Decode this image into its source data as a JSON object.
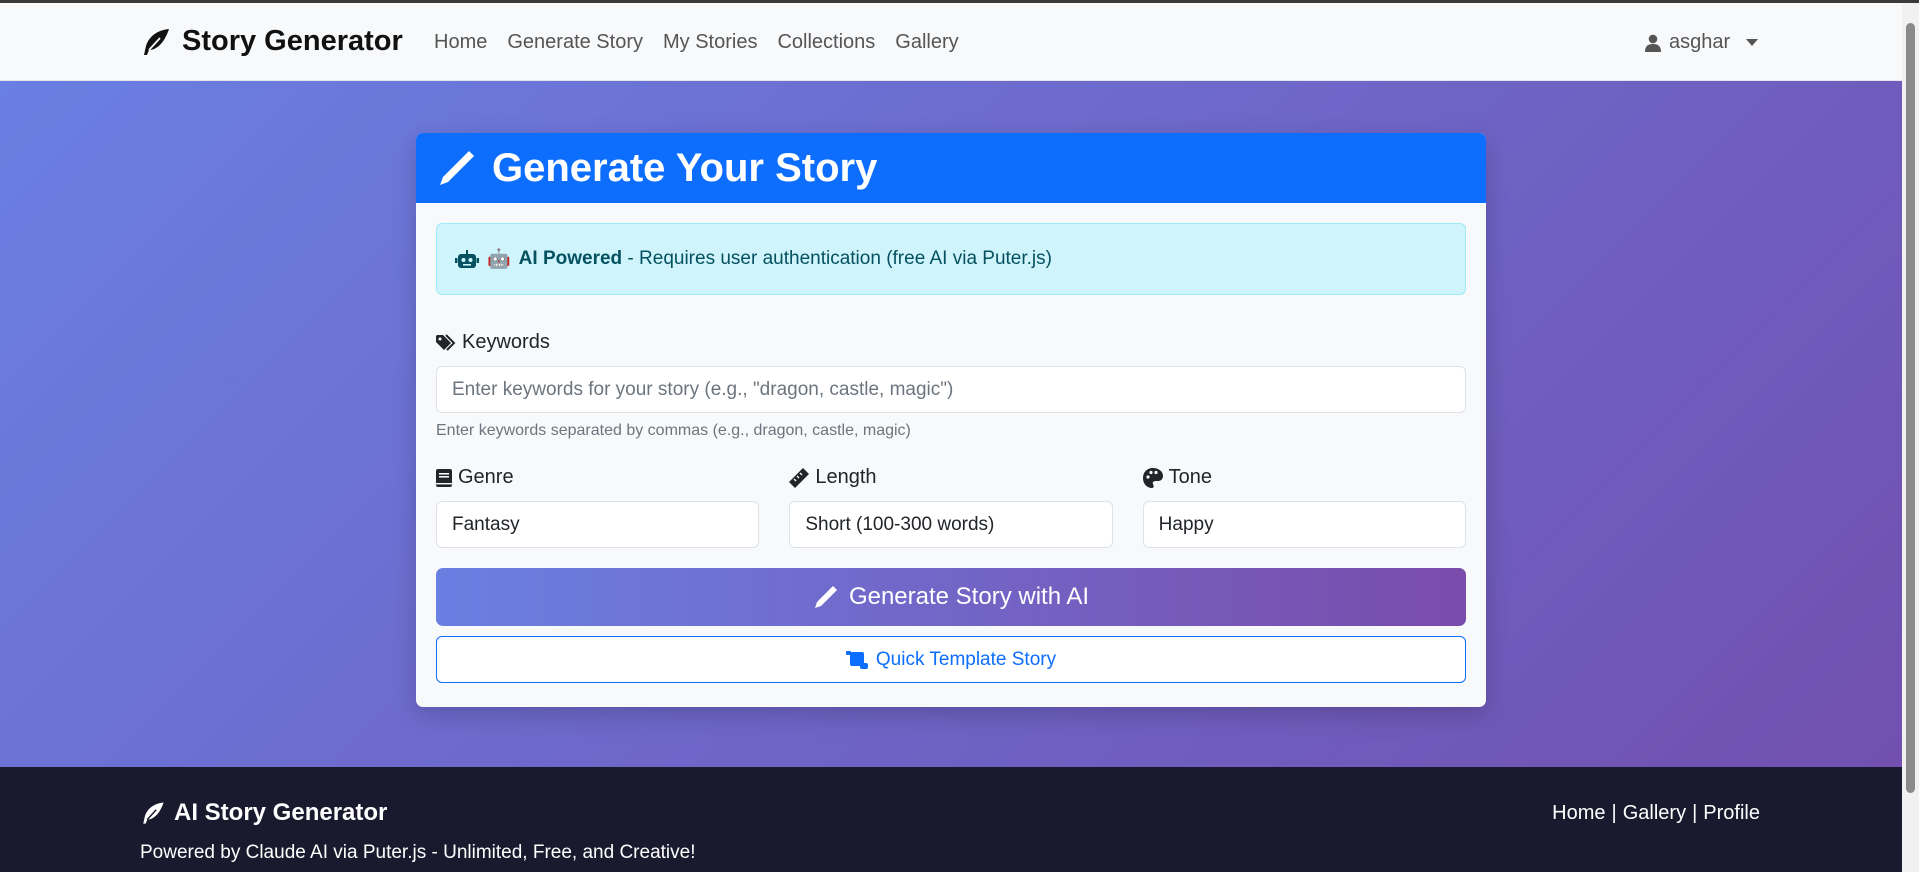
{
  "navbar": {
    "brand": "Story Generator",
    "links": [
      "Home",
      "Generate Story",
      "My Stories",
      "Collections",
      "Gallery"
    ],
    "user": "asghar"
  },
  "card": {
    "title": "Generate Your Story",
    "alert": {
      "bold": "AI Powered",
      "text": " - Requires user authentication (free AI via Puter.js)",
      "emoji": "🤖"
    },
    "keywords": {
      "label": "Keywords",
      "placeholder": "Enter keywords for your story (e.g., \"dragon, castle, magic\")",
      "help": "Enter keywords separated by commas (e.g., dragon, castle, magic)"
    },
    "genre": {
      "label": "Genre",
      "value": "Fantasy"
    },
    "length": {
      "label": "Length",
      "value": "Short (100-300 words)"
    },
    "tone": {
      "label": "Tone",
      "value": "Happy"
    },
    "generate_button": "Generate Story with AI",
    "template_button": "Quick Template Story"
  },
  "footer": {
    "brand": "AI Story Generator",
    "tagline": "Powered by Claude AI via Puter.js - Unlimited, Free, and Creative!",
    "links": [
      "Home",
      "Gallery",
      "Profile"
    ],
    "separator": "|"
  },
  "colors": {
    "primary": "#0d6efd",
    "gradient_start": "#6a7fe2",
    "gradient_end": "#7150b0",
    "footer_bg": "#1a1a2e",
    "alert_bg": "#cff4fc"
  }
}
